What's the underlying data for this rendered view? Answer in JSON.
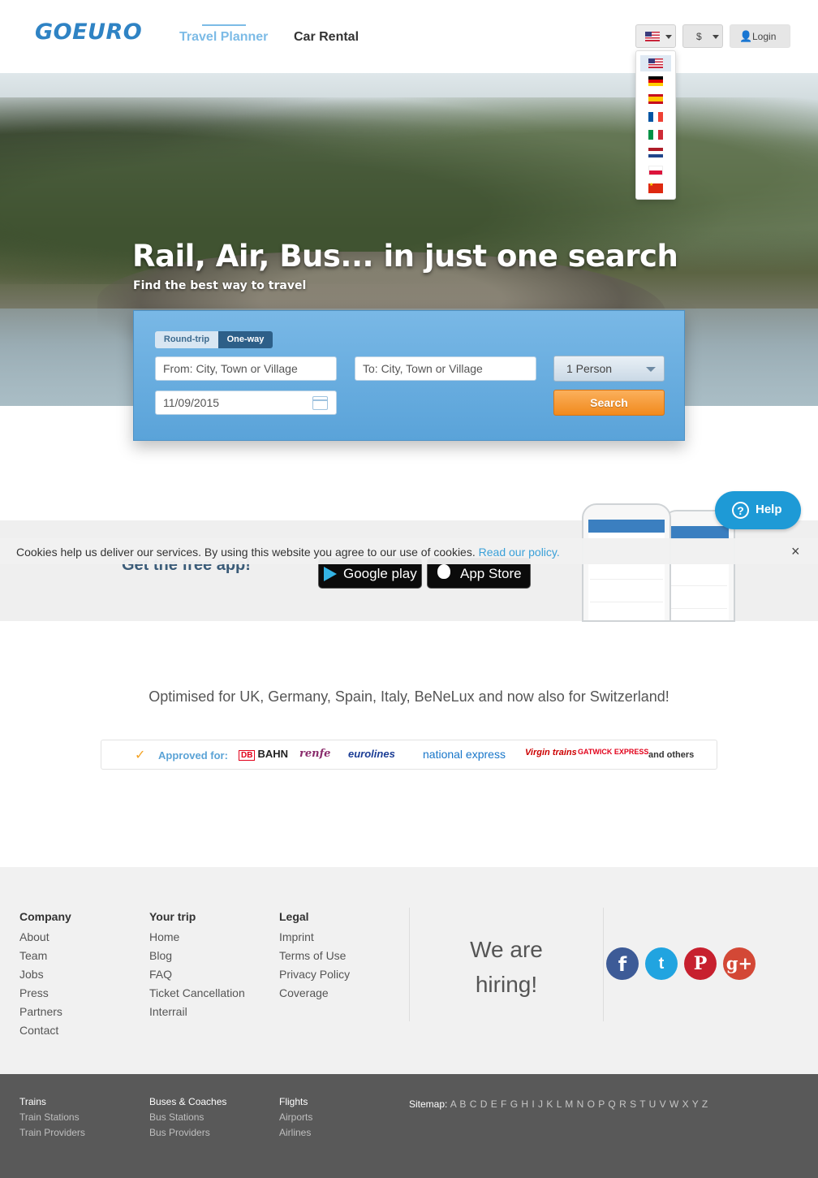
{
  "header": {
    "logo": "GOEURO",
    "nav": {
      "travel_planner": "Travel Planner",
      "car_rental": "Car Rental"
    },
    "currency": "$",
    "login": "Login",
    "languages": [
      "English (US)",
      "Deutsch",
      "Español",
      "Français",
      "Italiano",
      "Nederlands",
      "Polski",
      "中文"
    ]
  },
  "hero": {
    "title": "Rail, Air, Bus... in just one search",
    "subtitle": "Find the best way to travel"
  },
  "search": {
    "round_trip": "Round-trip",
    "one_way": "One-way",
    "from_placeholder": "From: City, Town or Village",
    "to_placeholder": "To: City, Town or Village",
    "date": "11/09/2015",
    "persons": "1 Person",
    "submit": "Search"
  },
  "app": {
    "text": "Get the free app!",
    "google_play": "Google play",
    "app_store": "App Store"
  },
  "help": {
    "label": "Help"
  },
  "cookie": {
    "text": "Cookies help us deliver our services. By using this website you agree to our use of cookies.",
    "link": "Read our policy.",
    "close": "×"
  },
  "optimised": "Optimised for UK, Germany, Spain, Italy, BeNeLux and now also for Switzerland!",
  "approved": {
    "label": "Approved for:",
    "partners": {
      "db_box": "DB",
      "db": "BAHN",
      "renfe": "renfe",
      "eurolines": "eurolines",
      "national_express": "national express",
      "virgin": "Virgin trains",
      "gatwick": "GATWICK EXPRESS"
    },
    "others": "and others"
  },
  "footer": {
    "company": {
      "title": "Company",
      "links": [
        "About",
        "Team",
        "Jobs",
        "Press",
        "Partners",
        "Contact"
      ]
    },
    "trip": {
      "title": "Your trip",
      "links": [
        "Home",
        "Blog",
        "FAQ",
        "Ticket Cancellation",
        "Interrail"
      ]
    },
    "legal": {
      "title": "Legal",
      "links": [
        "Imprint",
        "Terms of Use",
        "Privacy Policy",
        "Coverage"
      ]
    },
    "hiring_line1": "We are",
    "hiring_line2": "hiring!",
    "social": {
      "facebook": "f",
      "twitter": "t",
      "pinterest": "P",
      "googleplus": "g+"
    }
  },
  "bottom": {
    "trains": {
      "title": "Trains",
      "links": [
        "Train Stations",
        "Train Providers"
      ]
    },
    "buses": {
      "title": "Buses & Coaches",
      "links": [
        "Bus Stations",
        "Bus Providers"
      ]
    },
    "flights": {
      "title": "Flights",
      "links": [
        "Airports",
        "Airlines"
      ]
    },
    "sitemap_label": "Sitemap:",
    "sitemap_letters": "A B C D E F G H I J K L M N O P Q R S T U V W X Y Z"
  },
  "colors": {
    "brand": "#2f83c4",
    "accent": "#f18a1d",
    "help": "#1e9ad6"
  }
}
